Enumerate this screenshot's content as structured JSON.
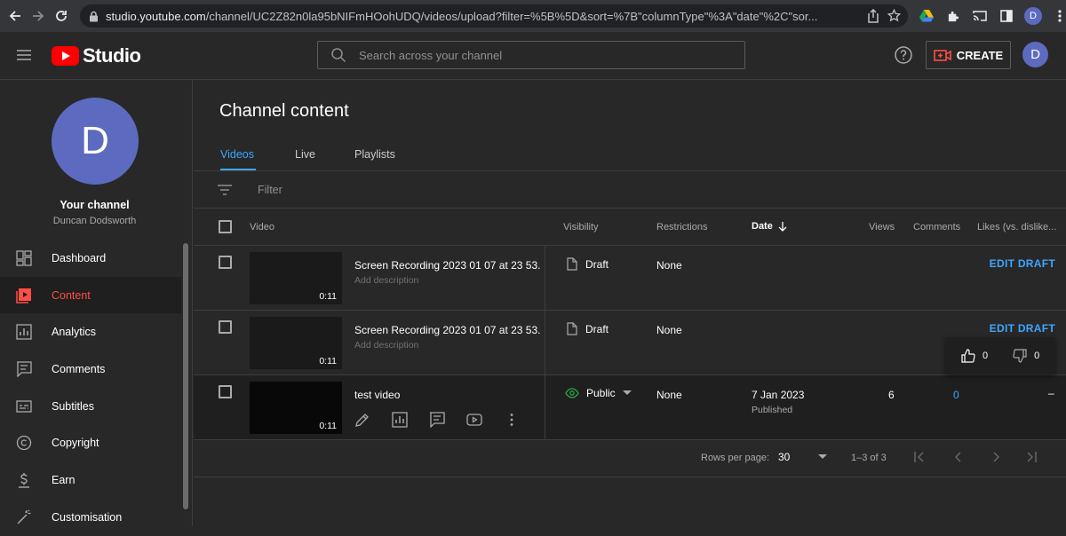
{
  "browser": {
    "url_host": "studio.youtube.com",
    "url_path": "/channel/UC2Z82n0la95bNIFmHOohUDQ/videos/upload?filter=%5B%5D&sort=%7B\"columnType\"%3A\"date\"%2C\"sor...",
    "profile_initial": "D"
  },
  "header": {
    "logo_text": "Studio",
    "search_placeholder": "Search across your channel",
    "create_label": "CREATE",
    "avatar_initial": "D"
  },
  "sidebar": {
    "avatar_initial": "D",
    "channel_title": "Your channel",
    "channel_name": "Duncan Dodsworth",
    "items": [
      {
        "label": "Dashboard",
        "icon": "dashboard-icon"
      },
      {
        "label": "Content",
        "icon": "content-icon",
        "active": true
      },
      {
        "label": "Analytics",
        "icon": "analytics-icon"
      },
      {
        "label": "Comments",
        "icon": "comments-icon"
      },
      {
        "label": "Subtitles",
        "icon": "subtitles-icon"
      },
      {
        "label": "Copyright",
        "icon": "copyright-icon"
      },
      {
        "label": "Earn",
        "icon": "earn-icon"
      },
      {
        "label": "Customisation",
        "icon": "customisation-icon"
      }
    ]
  },
  "main": {
    "title": "Channel content",
    "tabs": [
      {
        "label": "Videos",
        "active": true
      },
      {
        "label": "Live"
      },
      {
        "label": "Playlists"
      }
    ],
    "filter_placeholder": "Filter",
    "columns": {
      "video": "Video",
      "visibility": "Visibility",
      "restrictions": "Restrictions",
      "date": "Date",
      "views": "Views",
      "comments": "Comments",
      "likes": "Likes (vs. dislike..."
    },
    "rows": [
      {
        "title": "Screen Recording 2023 01 07 at 23 53...",
        "description": "Add description",
        "duration": "0:11",
        "visibility": "Draft",
        "restrictions": "None",
        "action": "EDIT DRAFT"
      },
      {
        "title": "Screen Recording 2023 01 07 at 23 53...",
        "description": "Add description",
        "duration": "0:11",
        "visibility": "Draft",
        "restrictions": "None",
        "action": "EDIT DRAFT"
      },
      {
        "title": "test video",
        "duration": "0:11",
        "visibility": "Public",
        "restrictions": "None",
        "date": "7 Jan 2023",
        "date_status": "Published",
        "views": "6",
        "comments": "0",
        "likes": "–"
      }
    ],
    "likes_popup": {
      "likes": "0",
      "dislikes": "0"
    },
    "pager": {
      "rows_per_page_label": "Rows per page:",
      "rows_per_page": "30",
      "range": "1–3 of 3"
    }
  },
  "colors": {
    "accent_blue": "#3ea6ff",
    "active_red": "#ff4e45",
    "avatar": "#5c6bc0",
    "public_green": "#2ba640"
  }
}
